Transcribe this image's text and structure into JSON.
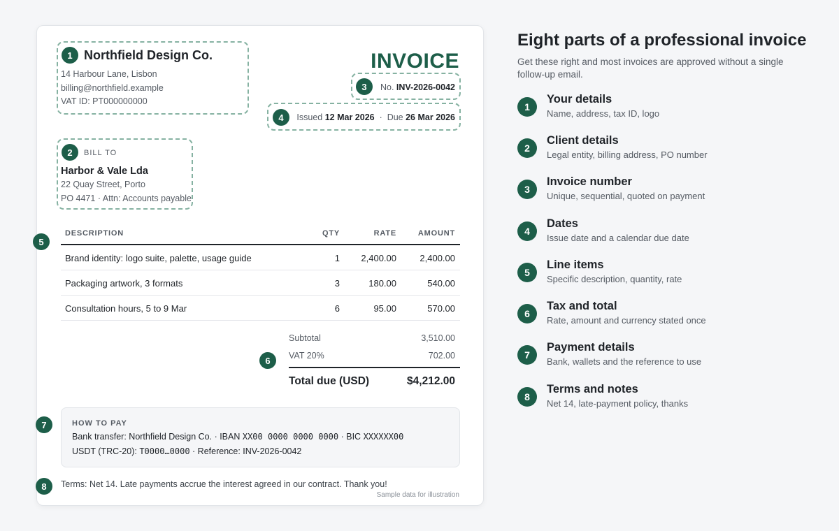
{
  "invoice": {
    "seller": {
      "name": "Northfield Design Co.",
      "address": "14 Harbour Lane, Lisbon",
      "email": "billing@northfield.example",
      "vat": "VAT ID: PT000000000"
    },
    "title": "INVOICE",
    "number_label": "No.",
    "number": "INV-2026-0042",
    "issued_label": "Issued",
    "issued_date": "12 Mar 2026",
    "separator": "·",
    "due_label": "Due",
    "due_date": "26 Mar 2026",
    "bill_to": {
      "label": "BILL TO",
      "name": "Harbor & Vale Lda",
      "address": "22 Quay Street, Porto",
      "po": "PO 4471 · Attn: Accounts payable"
    },
    "table": {
      "headers": [
        "DESCRIPTION",
        "QTY",
        "RATE",
        "AMOUNT"
      ],
      "rows": [
        {
          "description": "Brand identity: logo suite, palette, usage guide",
          "qty": "1",
          "rate": "2,400.00",
          "amount": "2,400.00"
        },
        {
          "description": "Packaging artwork, 3 formats",
          "qty": "3",
          "rate": "180.00",
          "amount": "540.00"
        },
        {
          "description": "Consultation hours, 5 to 9 Mar",
          "qty": "6",
          "rate": "95.00",
          "amount": "570.00"
        }
      ]
    },
    "summary": {
      "subtotal_label": "Subtotal",
      "subtotal": "3,510.00",
      "vat_label": "VAT 20%",
      "vat": "702.00",
      "total_label": "Total due (USD)",
      "total": "$4,212.00"
    },
    "payment": {
      "title": "HOW TO PAY",
      "bank_prefix": "Bank transfer: Northfield Design Co. · IBAN ",
      "iban": "XX00 0000 0000 0000",
      "bic_prefix": " · BIC ",
      "bic": "XXXXXX00",
      "usdt_prefix": "USDT (TRC-20): ",
      "wallet": "T0000…0000",
      "usdt_suffix": " · Reference: INV-2026-0042"
    },
    "terms": "Terms: Net 14. Late payments accrue the interest agreed in our contract. Thank you!",
    "sample_note": "Sample data for illustration",
    "badges": [
      "1",
      "2",
      "3",
      "4",
      "5",
      "6",
      "7",
      "8"
    ]
  },
  "guide": {
    "title": "Eight parts of a professional invoice",
    "subtitle": "Get these right and most invoices are approved without a single follow-up email.",
    "items": [
      {
        "n": "1",
        "title": "Your details",
        "desc": "Name, address, tax ID, logo"
      },
      {
        "n": "2",
        "title": "Client details",
        "desc": "Legal entity, billing address, PO number"
      },
      {
        "n": "3",
        "title": "Invoice number",
        "desc": "Unique, sequential, quoted on payment"
      },
      {
        "n": "4",
        "title": "Dates",
        "desc": "Issue date and a calendar due date"
      },
      {
        "n": "5",
        "title": "Line items",
        "desc": "Specific description, quantity, rate"
      },
      {
        "n": "6",
        "title": "Tax and total",
        "desc": "Rate, amount and currency stated once"
      },
      {
        "n": "7",
        "title": "Payment details",
        "desc": "Bank, wallets and the reference to use"
      },
      {
        "n": "8",
        "title": "Terms and notes",
        "desc": "Net 14, late-payment policy, thanks"
      }
    ]
  },
  "colors": {
    "accent": "#1d5e49",
    "dashed_outline": "#86b2a2",
    "background": "#f5f6f8"
  }
}
